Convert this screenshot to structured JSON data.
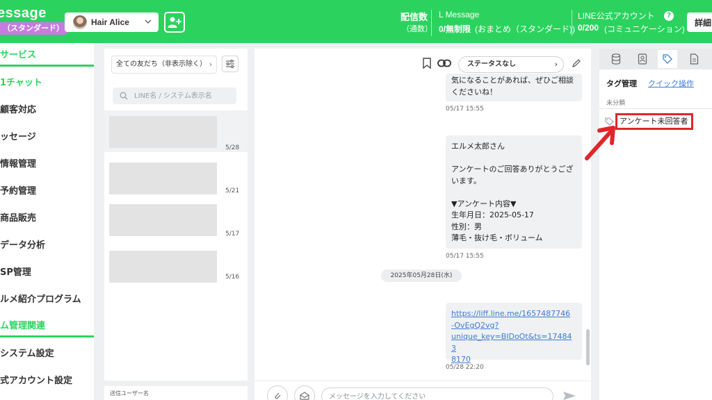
{
  "header": {
    "brand": "essage",
    "plan": "（スタンダード）",
    "account": "Hair Alice",
    "stat1_label": "配信数",
    "stat1_sub": "（通数）",
    "stat2_label": "L Message",
    "stat2_value": "0/無制限",
    "stat2_sub": "(おまとめ（スタンダード))",
    "stat3_label": "LINE公式アカウント",
    "stat3_value": "0/200",
    "stat3_sub": "(コミュニケーション)",
    "help": "?",
    "detail": "詳細",
    "icons": {
      "avatar": "avatar",
      "add_friend": "person-plus-icon",
      "chevron": "chevron-down-icon"
    }
  },
  "sidebar": {
    "section1": "サービス",
    "items1": [
      "1チャット",
      "顧客対応",
      "ッセージ",
      "情報管理",
      "予約管理",
      "商品販売",
      "データ分析",
      "SP管理",
      "ルメ紹介プログラム"
    ],
    "section2": "ム管理関連",
    "items2": [
      "システム設定",
      "式アカウント設定"
    ]
  },
  "friends": {
    "filter": "全ての友だち（非表示除く）",
    "search_placeholder": "LINE名 / システム表示名",
    "dates": [
      "5/28",
      "5/21",
      "5/17",
      "5/16"
    ],
    "sender_label": "送信ユーザー名"
  },
  "chat": {
    "status": "ステータスなし",
    "bubble1_text": "気になることがあれば、ぜひご相談\nくださいね！",
    "ts1": "05/17 15:55",
    "bubble2_text": "エルメ太郎さん\n\nアンケートのご回答ありがとうござ\nいます。\n\n▼アンケート内容▼\n生年月日：2025-05-17\n性別：男\n薄毛・抜け毛・ボリューム",
    "ts2": "05/17 15:55",
    "date_sep": "2025年05月28日(水)",
    "link_lines": [
      "https://liff.line.me/1657487746",
      "-OvEgQ2vg?",
      "unique_key=BIDoOt&ts=174843",
      "8170"
    ],
    "ts3": "05/28 22:20",
    "composer_placeholder": "メッセージを入力してください"
  },
  "right": {
    "title": "タグ管理",
    "quick": "クイック操作",
    "category": "未分類",
    "tag": "アンケート未回答者",
    "highlight_color": "#e0262b"
  },
  "colors": {
    "brand": "#2bd35e",
    "badge": "#c77be0",
    "link": "#3b7bd5"
  }
}
